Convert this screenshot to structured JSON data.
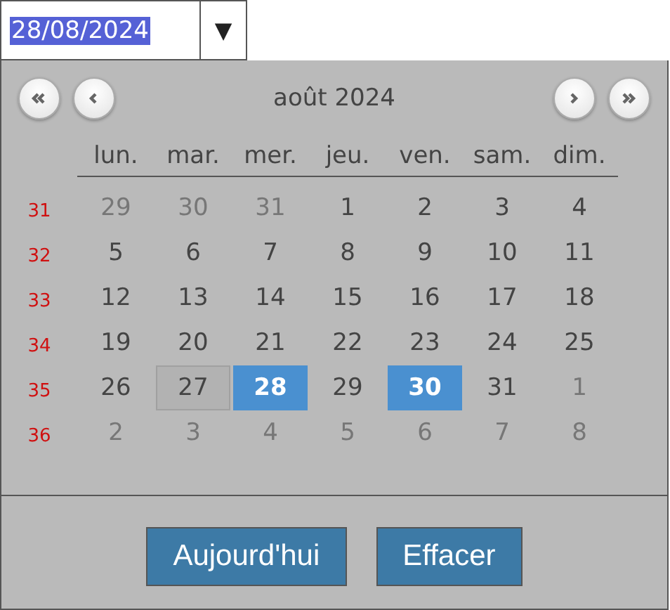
{
  "date_field": {
    "value": "28/08/2024",
    "text_selected": true,
    "toggle": "▼"
  },
  "calendar": {
    "title": "août 2024",
    "nav": [
      {
        "kind": "prev_year"
      },
      {
        "kind": "prev_month"
      },
      {
        "kind": "next_month"
      },
      {
        "kind": "next_year"
      }
    ],
    "weekdays": [
      "lun.",
      "mar.",
      "mer.",
      "jeu.",
      "ven.",
      "sam.",
      "dim."
    ],
    "weeks": [
      {
        "number": "31",
        "days": [
          {
            "label": "29",
            "other_month": true
          },
          {
            "label": "30",
            "other_month": true
          },
          {
            "label": "31",
            "other_month": true
          },
          {
            "label": "1"
          },
          {
            "label": "2"
          },
          {
            "label": "3"
          },
          {
            "label": "4"
          }
        ]
      },
      {
        "number": "32",
        "days": [
          {
            "label": "5"
          },
          {
            "label": "6"
          },
          {
            "label": "7"
          },
          {
            "label": "8"
          },
          {
            "label": "9"
          },
          {
            "label": "10"
          },
          {
            "label": "11"
          }
        ]
      },
      {
        "number": "33",
        "days": [
          {
            "label": "12"
          },
          {
            "label": "13"
          },
          {
            "label": "14"
          },
          {
            "label": "15"
          },
          {
            "label": "16"
          },
          {
            "label": "17"
          },
          {
            "label": "18"
          }
        ]
      },
      {
        "number": "34",
        "days": [
          {
            "label": "19"
          },
          {
            "label": "20"
          },
          {
            "label": "21"
          },
          {
            "label": "22"
          },
          {
            "label": "23"
          },
          {
            "label": "24"
          },
          {
            "label": "25"
          }
        ]
      },
      {
        "number": "35",
        "days": [
          {
            "label": "26"
          },
          {
            "label": "27",
            "hovered": true
          },
          {
            "label": "28",
            "selected": true
          },
          {
            "label": "29"
          },
          {
            "label": "30",
            "today": true
          },
          {
            "label": "31"
          },
          {
            "label": "1",
            "other_month": true
          }
        ]
      },
      {
        "number": "36",
        "days": [
          {
            "label": "2",
            "other_month": true
          },
          {
            "label": "3",
            "other_month": true
          },
          {
            "label": "4",
            "other_month": true
          },
          {
            "label": "5",
            "other_month": true
          },
          {
            "label": "6",
            "other_month": true
          },
          {
            "label": "7",
            "other_month": true
          },
          {
            "label": "8",
            "other_month": true
          }
        ]
      }
    ],
    "buttons": [
      "Aujourd'hui",
      "Effacer"
    ]
  }
}
